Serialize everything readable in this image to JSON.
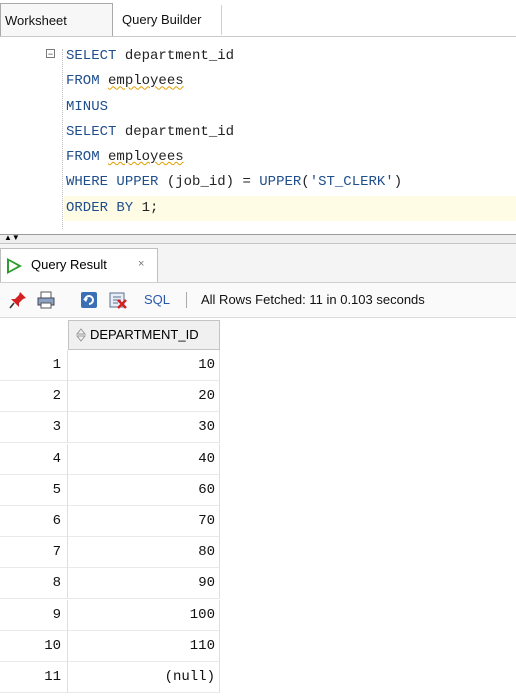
{
  "tabs": {
    "worksheet": "Worksheet",
    "query_builder": "Query Builder"
  },
  "editor": {
    "lines": [
      [
        {
          "t": "SELECT ",
          "c": "kw"
        },
        {
          "t": "department_id",
          "c": "tx"
        }
      ],
      [
        {
          "t": "FROM ",
          "c": "kw"
        },
        {
          "t": "employees",
          "c": "tx",
          "squig": true
        }
      ],
      [
        {
          "t": "MINUS",
          "c": "kw"
        }
      ],
      [
        {
          "t": "SELECT ",
          "c": "kw"
        },
        {
          "t": "department_id",
          "c": "tx"
        }
      ],
      [
        {
          "t": "FROM ",
          "c": "kw"
        },
        {
          "t": "employees",
          "c": "tx",
          "squig": true
        }
      ],
      [
        {
          "t": "WHERE ",
          "c": "kw"
        },
        {
          "t": "UPPER",
          "c": "kw"
        },
        {
          "t": " (job_id) = ",
          "c": "tx"
        },
        {
          "t": "UPPER",
          "c": "kw"
        },
        {
          "t": "(",
          "c": "tx"
        },
        {
          "t": "'ST_CLERK'",
          "c": "str"
        },
        {
          "t": ")",
          "c": "tx"
        }
      ],
      [
        {
          "t": "ORDER BY ",
          "c": "kw"
        },
        {
          "t": "1;",
          "c": "tx"
        }
      ]
    ],
    "fold_symbol": "−"
  },
  "result_tab": {
    "label": "Query Result",
    "close": "×"
  },
  "toolbar": {
    "sql_label": "SQL",
    "status": "All Rows Fetched: 11 in 0.103 seconds",
    "icons": [
      "pin-icon",
      "print-icon",
      "refresh-icon",
      "export-icon"
    ]
  },
  "grid": {
    "column": "DEPARTMENT_ID",
    "rows": [
      {
        "n": "1",
        "v": "10"
      },
      {
        "n": "2",
        "v": "20"
      },
      {
        "n": "3",
        "v": "30"
      },
      {
        "n": "4",
        "v": "40"
      },
      {
        "n": "5",
        "v": "60"
      },
      {
        "n": "6",
        "v": "70"
      },
      {
        "n": "7",
        "v": "80"
      },
      {
        "n": "8",
        "v": "90"
      },
      {
        "n": "9",
        "v": "100"
      },
      {
        "n": "10",
        "v": "110"
      },
      {
        "n": "11",
        "v": "(null)"
      }
    ]
  },
  "colors": {
    "keyword": "#1f4e8c",
    "run_green": "#2f9c2f",
    "link": "#2958a8",
    "current_line": "#fffce6"
  }
}
